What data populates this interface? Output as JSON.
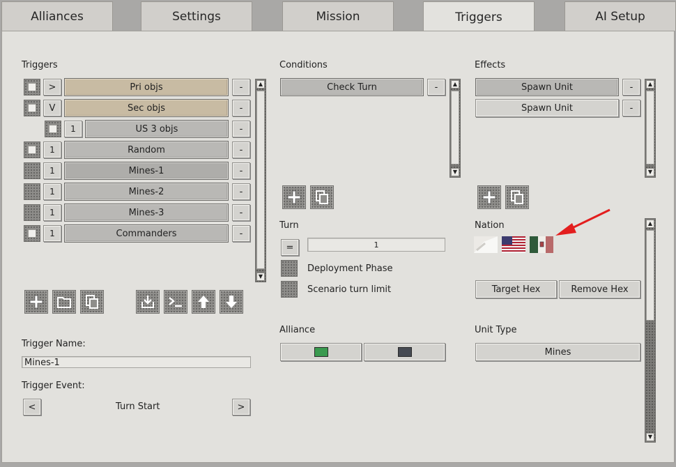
{
  "tabs": [
    "Alliances",
    "Settings",
    "Mission",
    "Triggers",
    "AI Setup"
  ],
  "active_tab": "Triggers",
  "triggers": {
    "heading": "Triggers",
    "rows": [
      {
        "toggle": ">",
        "label": "Pri objs",
        "style": "tan",
        "remove": "-"
      },
      {
        "toggle": "V",
        "label": "Sec objs",
        "style": "tan",
        "remove": "-"
      },
      {
        "toggle": "1",
        "label": "US 3 objs",
        "style": "plain",
        "remove": "-"
      },
      {
        "toggle": "1",
        "label": "Random",
        "style": "plain",
        "remove": "-"
      },
      {
        "toggle": "1",
        "label": "Mines-1",
        "style": "selected",
        "remove": "-"
      },
      {
        "toggle": "1",
        "label": "Mines-2",
        "style": "plain",
        "remove": "-"
      },
      {
        "toggle": "1",
        "label": "Mines-3",
        "style": "plain",
        "remove": "-"
      },
      {
        "toggle": "1",
        "label": "Commanders",
        "style": "plain",
        "remove": "-"
      }
    ],
    "name_label": "Trigger Name:",
    "name_value": "Mines-1",
    "event_label": "Trigger Event:",
    "event_value": "Turn Start",
    "event_prev": "<",
    "event_next": ">"
  },
  "conditions": {
    "heading": "Conditions",
    "items": [
      {
        "label": "Check Turn",
        "remove": "-"
      }
    ],
    "turn_label": "Turn",
    "turn_operator": "=",
    "turn_value": "1",
    "deployment_label": "Deployment Phase",
    "limit_label": "Scenario turn limit",
    "alliance_label": "Alliance",
    "alliance_colors": [
      "#3a9a4f",
      "#464a52"
    ]
  },
  "effects": {
    "heading": "Effects",
    "items": [
      {
        "label": "Spawn Unit",
        "remove": "-"
      },
      {
        "label": "Spawn Unit",
        "remove": "-"
      }
    ],
    "nation_label": "Nation",
    "nation_flags": [
      "white-flag-icon",
      "us-flag-icon",
      "italy-flag-icon"
    ],
    "target_hex_label": "Target Hex",
    "remove_hex_label": "Remove Hex",
    "unit_type_label": "Unit Type",
    "unit_type_value": "Mines"
  },
  "colors": {
    "annotation_arrow": "#e31e1e",
    "tan_button": "#c8bba3"
  }
}
